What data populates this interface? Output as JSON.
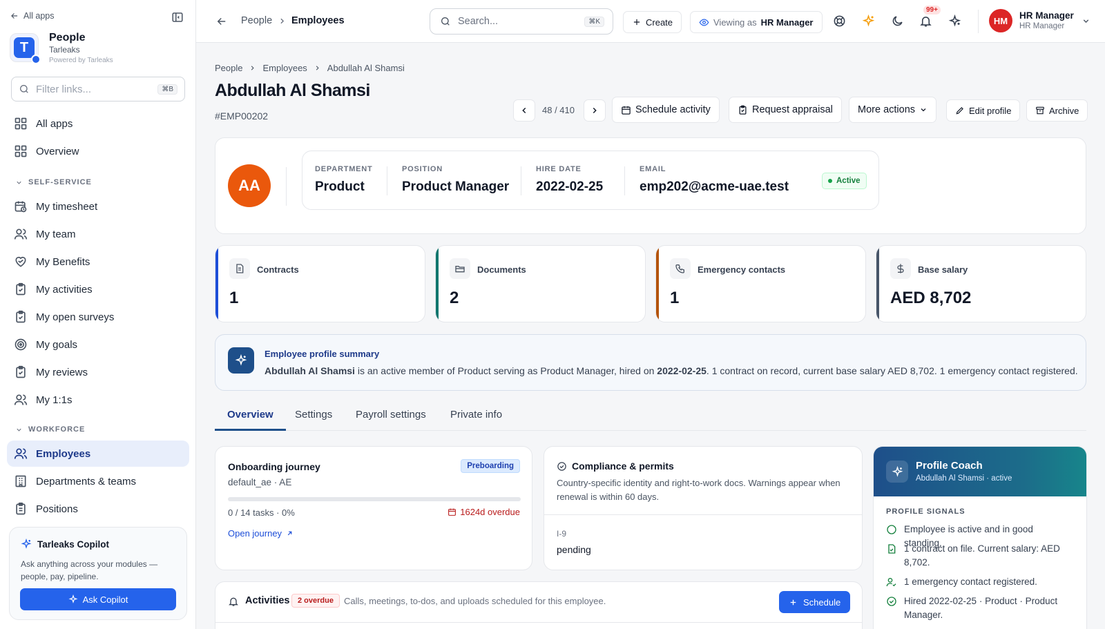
{
  "sidebar": {
    "back_label": "All apps",
    "app_name": "People",
    "company": "Tarleaks",
    "powered_by": "Powered by Tarleaks",
    "filter_placeholder": "Filter links...",
    "filter_shortcut": "⌘B",
    "top_items": [
      {
        "label": "All apps",
        "icon": "grid-icon"
      },
      {
        "label": "Overview",
        "icon": "grid-icon"
      }
    ],
    "self_service_label": "SELF-SERVICE",
    "self_service_items": [
      {
        "label": "My timesheet",
        "icon": "calendar-clock-icon"
      },
      {
        "label": "My team",
        "icon": "users-icon"
      },
      {
        "label": "My Benefits",
        "icon": "heart-handshake-icon"
      },
      {
        "label": "My activities",
        "icon": "clipboard-check-icon"
      },
      {
        "label": "My open surveys",
        "icon": "clipboard-check-icon"
      },
      {
        "label": "My goals",
        "icon": "target-icon"
      },
      {
        "label": "My reviews",
        "icon": "clipboard-check-icon"
      },
      {
        "label": "My 1:1s",
        "icon": "users-icon"
      }
    ],
    "workforce_label": "WORKFORCE",
    "workforce_items": [
      {
        "label": "Employees",
        "icon": "users-icon",
        "active": true
      },
      {
        "label": "Departments & teams",
        "icon": "building-icon"
      },
      {
        "label": "Positions",
        "icon": "clipboard-icon"
      }
    ],
    "copilot": {
      "title": "Tarleaks Copilot",
      "description": "Ask anything across your modules — people, pay, pipeline.",
      "button_label": "Ask Copilot"
    }
  },
  "topbar": {
    "breadcrumb_root": "People",
    "breadcrumb_current": "Employees",
    "search_placeholder": "Search...",
    "search_shortcut": "⌘K",
    "create_label": "Create",
    "viewing_as_prefix": "Viewing as",
    "viewing_as_role": "HR Manager",
    "notification_count": "99+",
    "user_initials": "HM",
    "user_name": "HR Manager",
    "user_role": "HR Manager"
  },
  "page": {
    "breadcrumb": [
      "People",
      "Employees",
      "Abdullah Al Shamsi"
    ],
    "title": "Abdullah Al Shamsi",
    "employee_id": "#EMP00202",
    "pager": "48 / 410",
    "actions": {
      "schedule_activity": "Schedule activity",
      "request_appraisal": "Request appraisal",
      "more_actions": "More actions",
      "edit_profile": "Edit profile",
      "archive": "Archive"
    }
  },
  "profile": {
    "initials": "AA",
    "avatar_color": "#ea580c",
    "department_label": "DEPARTMENT",
    "department": "Product",
    "position_label": "POSITION",
    "position": "Product Manager",
    "hire_date_label": "HIRE DATE",
    "hire_date": "2022-02-25",
    "email_label": "EMAIL",
    "email": "emp202@acme-uae.test",
    "status": "Active"
  },
  "stats": [
    {
      "label": "Contracts",
      "value": "1",
      "icon": "file-text-icon",
      "color": "#1d4ed8"
    },
    {
      "label": "Documents",
      "value": "2",
      "icon": "folder-open-icon",
      "color": "#0f766e"
    },
    {
      "label": "Emergency contacts",
      "value": "1",
      "icon": "phone-icon",
      "color": "#b45309"
    },
    {
      "label": "Base salary",
      "value": "AED 8,702",
      "icon": "dollar-icon",
      "color": "#475569"
    }
  ],
  "summary": {
    "title": "Employee profile summary",
    "name": "Abdullah Al Shamsi",
    "text1": " is an active member of Product serving as Product Manager, hired on ",
    "date": "2022-02-25",
    "text2": ". 1 contract on record, current base salary AED 8,702. 1 emergency contact registered."
  },
  "tabs": [
    {
      "label": "Overview",
      "active": true
    },
    {
      "label": "Settings"
    },
    {
      "label": "Payroll settings"
    },
    {
      "label": "Private info"
    }
  ],
  "onboarding": {
    "title": "Onboarding journey",
    "badge": "Preboarding",
    "template": "default_ae · AE",
    "progress": 0,
    "progress_text": "0 / 14 tasks · 0%",
    "overdue": "1624d overdue",
    "link": "Open journey"
  },
  "compliance": {
    "title": "Compliance & permits",
    "description": "Country-specific identity and right-to-work docs. Warnings appear when renewal is within 60 days.",
    "doc_label": "I-9",
    "doc_status": "pending"
  },
  "coach": {
    "title": "Profile Coach",
    "subtitle": "Abdullah Al Shamsi · active",
    "signals_label": "PROFILE SIGNALS",
    "signals": [
      {
        "text": "Employee is active and in good standing.",
        "icon": "circle-icon"
      },
      {
        "text": "1 contract on file. Current salary: AED 8,702.",
        "icon": "file-check-icon"
      },
      {
        "text": "1 emergency contact registered.",
        "icon": "user-check-icon"
      },
      {
        "text": "Hired 2022-02-25 · Product · Product Manager.",
        "icon": "check-circle-icon"
      }
    ]
  },
  "activities": {
    "title": "Activities",
    "overdue_badge": "2 overdue",
    "description": "Calls, meetings, to-dos, and uploads scheduled for this employee.",
    "schedule_label": "Schedule"
  }
}
